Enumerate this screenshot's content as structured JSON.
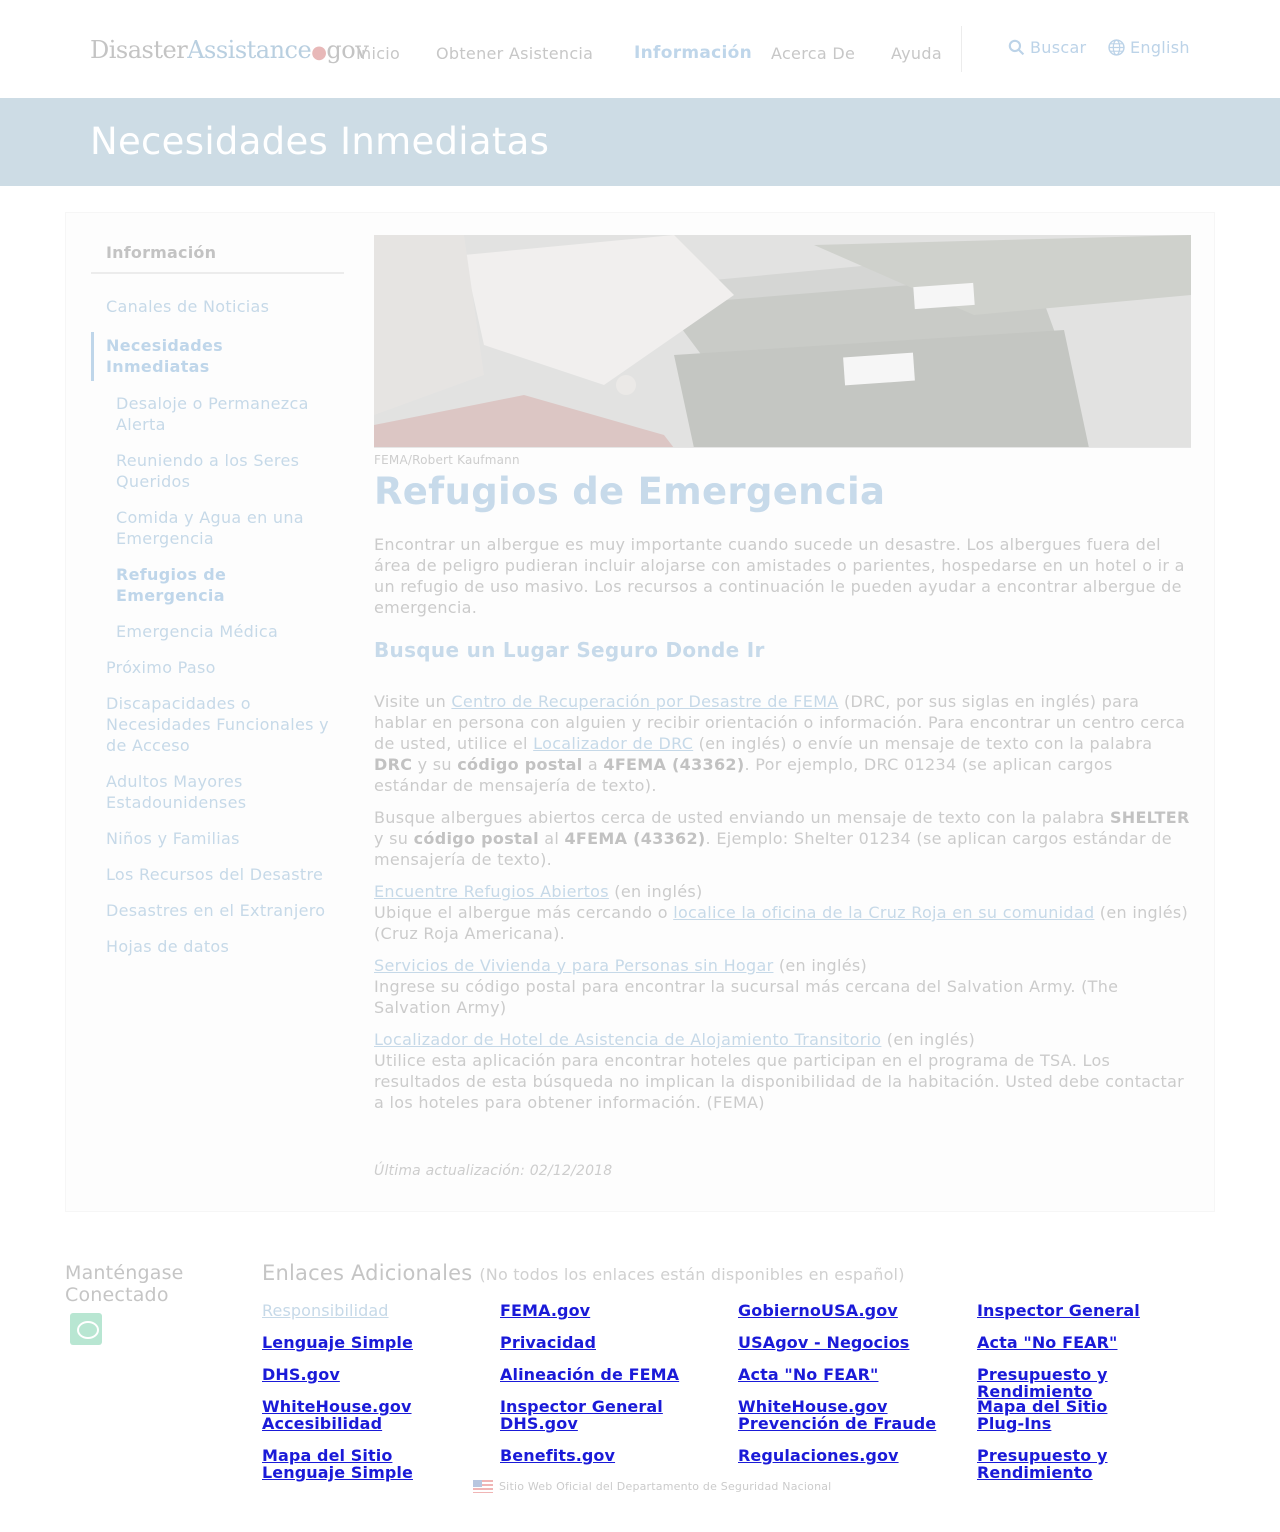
{
  "header": {
    "logo": {
      "part1": "Disaster",
      "part2": "Assistance",
      "dot": "●",
      "part3": "gov"
    },
    "nav": [
      "Inicio",
      "Obtener Asistencia",
      "Información",
      "Acerca De",
      "Ayuda"
    ],
    "search_label": "Buscar",
    "language_label": "English"
  },
  "hero": {
    "title": "Necesidades Inmediatas"
  },
  "sidebar": {
    "title": "Información",
    "items": [
      "Canales de Noticias",
      "Necesidades Inmediatas",
      "Desaloje o Permanezca Alerta",
      "Reuniendo a los Seres Queridos",
      "Comida y Agua en una Emergencia",
      "Refugios de Emergencia",
      "Emergencia Médica",
      "Próximo Paso",
      "Discapacidades o Necesidades Funcionales y de Acceso",
      "Adultos Mayores Estadounidenses",
      "Niños y Familias",
      "Los Recursos del Desastre",
      "Desastres en el Extranjero",
      "Hojas de datos"
    ]
  },
  "content": {
    "photo_credit": "FEMA/Robert Kaufmann",
    "title": "Refugios de Emergencia",
    "intro": "Encontrar un albergue es muy importante cuando sucede un desastre. Los albergues fuera del área de peligro pudieran incluir alojarse con amistades o parientes, hospedarse en un hotel o ir a un refugio de uso masivo. Los recursos a continuación le pueden ayudar a encontrar albergue de emergencia.",
    "section_title": "Busque un Lugar Seguro Donde Ir",
    "drc": {
      "t1": "Visite un ",
      "link1": "Centro de Recuperación por Desastre de FEMA",
      "t2": " (DRC, por sus siglas en inglés) para hablar en persona con alguien y recibir orientación o información. Para encontrar un centro cerca de usted, utilice el ",
      "link2": "Localizador de DRC",
      "t3": " (en inglés) o envíe un mensaje de texto con la palabra ",
      "b1": "DRC",
      "t4": " y su ",
      "b2": "código postal",
      "t5": " a ",
      "b3": "4FEMA (43362)",
      "t6": ". Por ejemplo, DRC 01234 (se aplican cargos estándar de mensajería de texto)."
    },
    "shelter": {
      "t1": "Busque albergues abiertos cerca de usted enviando un mensaje de texto con la palabra ",
      "b1": "SHELTER",
      "t2": " y su ",
      "b2": "código postal",
      "t3": " al ",
      "b3": "4FEMA (43362)",
      "t4": ". Ejemplo: Shelter 01234 (se aplican cargos estándar de mensajería de texto)."
    },
    "open_shelters": {
      "link": "Encuentre Refugios Abiertos",
      "note": " (en inglés)",
      "t1": "Ubique el albergue más cercando o ",
      "link2": "localice la oficina de la Cruz Roja en su comunidad",
      "t2": " (en inglés) (Cruz Roja Americana)."
    },
    "housing": {
      "link": "Servicios de Vivienda y para Personas sin Hogar",
      "note": " (en inglés)",
      "text": "Ingrese su código postal para encontrar la sucursal más cercana del Salvation Army. (The Salvation Army)"
    },
    "hotel": {
      "link": "Localizador de Hotel de Asistencia de Alojamiento Transitorio",
      "note": " (en inglés)",
      "text": "Utilice esta aplicación para encontrar hoteles que participan en el programa de TSA. Los resultados de esta búsqueda no implican la disponibilidad de la habitación. Usted debe contactar a los hoteles para obtener información. (FEMA)"
    },
    "updated": "Última actualización: 02/12/2018"
  },
  "footer": {
    "stay_connected": "Manténgase Conectado",
    "more_links_title": "Enlaces Adicionales",
    "more_links_note": "(No todos los enlaces están disponibles en español)",
    "links": [
      "Responsibilidad",
      "FEMA.gov",
      "GobiernoUSA.gov",
      "Inspector General",
      "Lenguaje Simple",
      "Privacidad",
      "USAgov - Negocios",
      "Acta \"No FEAR\"",
      "DHS.gov",
      "Alineación de FEMA",
      "Acta \"No FEAR\"",
      "Presupuesto y Rendimiento",
      "WhiteHouse.gov",
      "Inspector General",
      "WhiteHouse.gov",
      "Mapa del Sitio",
      "Accesibilidad",
      "DHS.gov",
      "Prevención de Fraude",
      "Plug-Ins",
      "Mapa del Sitio",
      "Benefits.gov",
      "Regulaciones.gov",
      "Presupuesto y Rendimiento",
      "Lenguaje Simple"
    ],
    "official": "Sitio Web Oficial del Departamento de Seguridad Nacional"
  },
  "colors": {
    "hero_bg": "#cddce5",
    "accent": "#bfd6ea",
    "footer_link": "#1a1ad8"
  }
}
